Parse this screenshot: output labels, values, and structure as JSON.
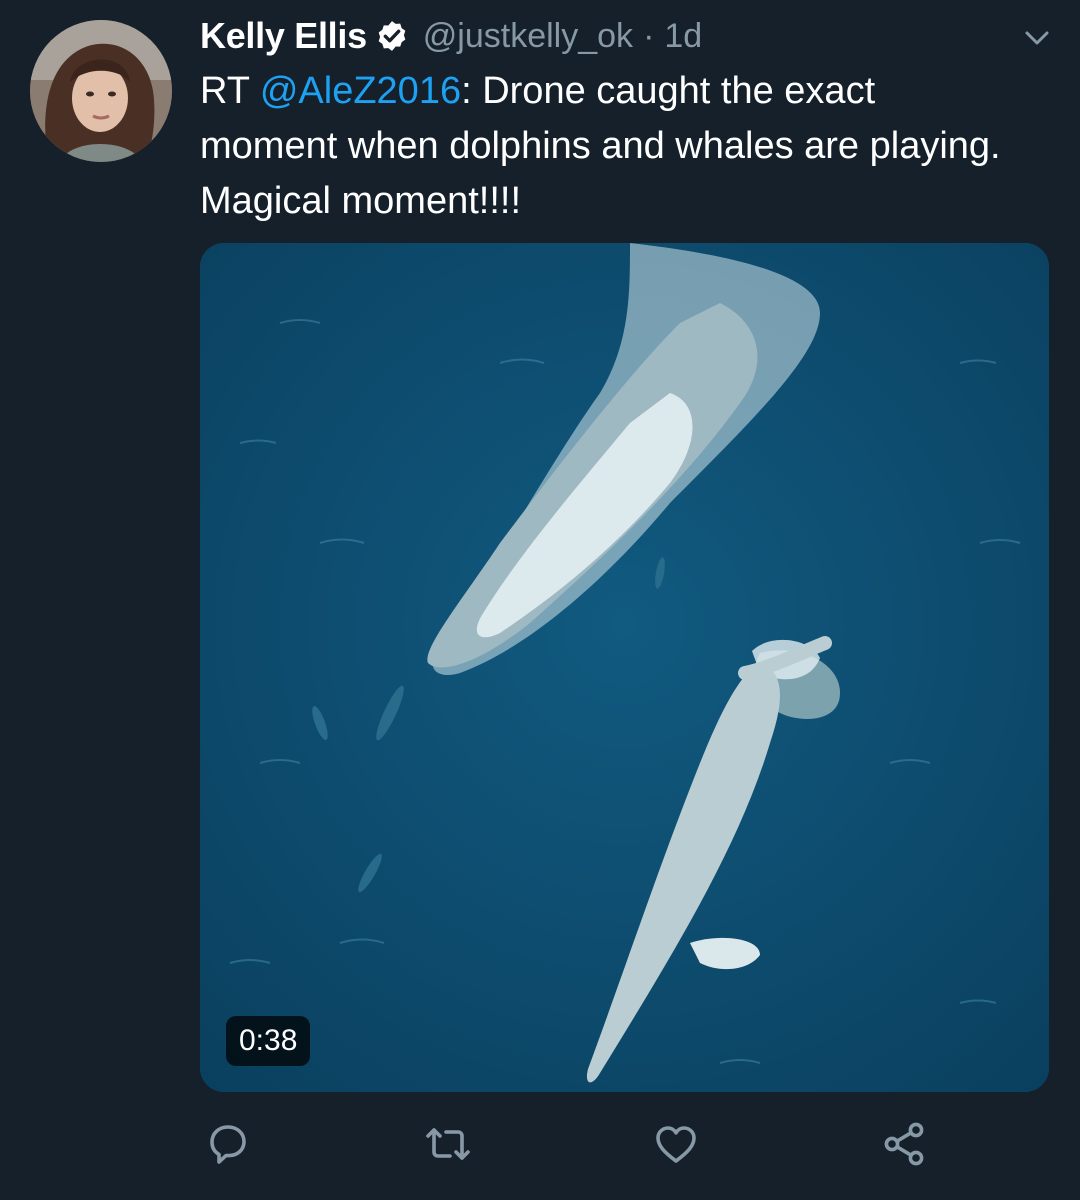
{
  "tweet": {
    "author_name": "Kelly Ellis",
    "author_handle": "@justkelly_ok",
    "separator": "·",
    "timestamp": "1d",
    "retweet_prefix": "RT ",
    "mention": "@AleZ2016",
    "body": ": Drone caught the exact moment when dolphins and whales are playing. Magical moment!!!!"
  },
  "media": {
    "type": "video",
    "duration": "0:38"
  },
  "icons": {
    "verified": "verified-badge-icon",
    "menu": "chevron-down-icon",
    "reply": "reply-icon",
    "retweet": "retweet-icon",
    "like": "heart-icon",
    "share": "share-icon"
  },
  "colors": {
    "background": "#15202b",
    "accent": "#1da1f2",
    "muted": "#8899a6",
    "text": "#ffffff"
  }
}
